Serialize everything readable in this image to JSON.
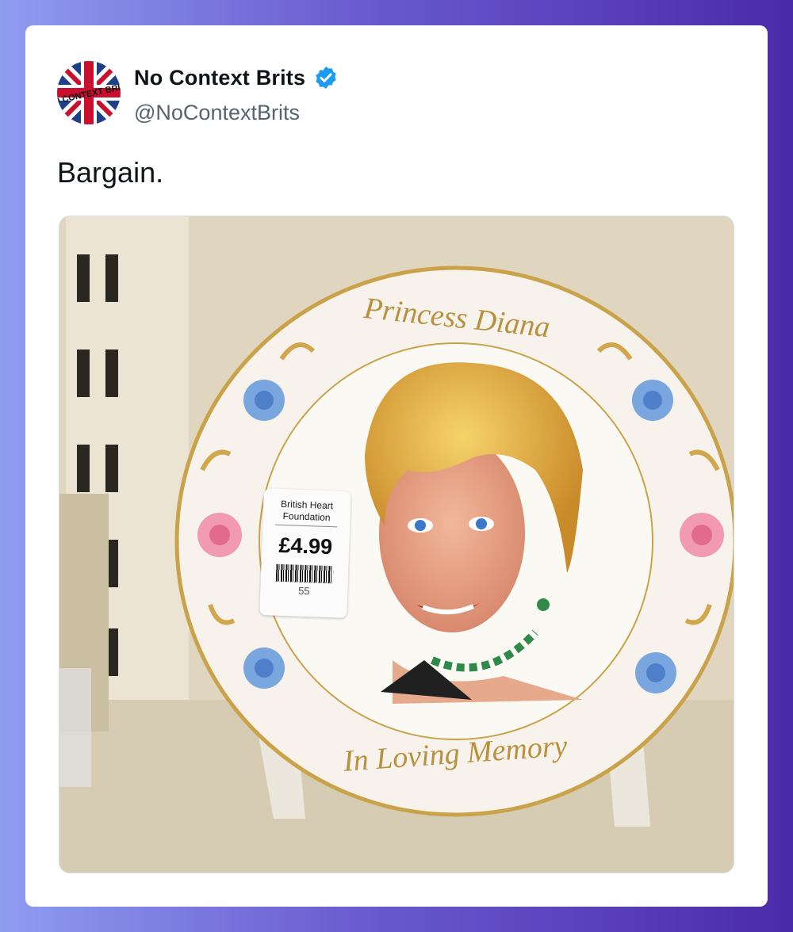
{
  "tweet": {
    "display_name": "No Context Brits",
    "handle": "@NoContextBrits",
    "verified": true,
    "text": "Bargain.",
    "avatar_text": "NO CONTEXT BRITS"
  },
  "media": {
    "plate_top_text": "Princess Diana",
    "plate_bottom_text": "In Loving Memory",
    "price_tag": {
      "org_line1": "British Heart",
      "org_line2": "Foundation",
      "price": "£4.99",
      "code": "55"
    }
  },
  "colors": {
    "accent_verified": "#1d9bf0",
    "text_primary": "#0f1419",
    "text_secondary": "#536471"
  }
}
